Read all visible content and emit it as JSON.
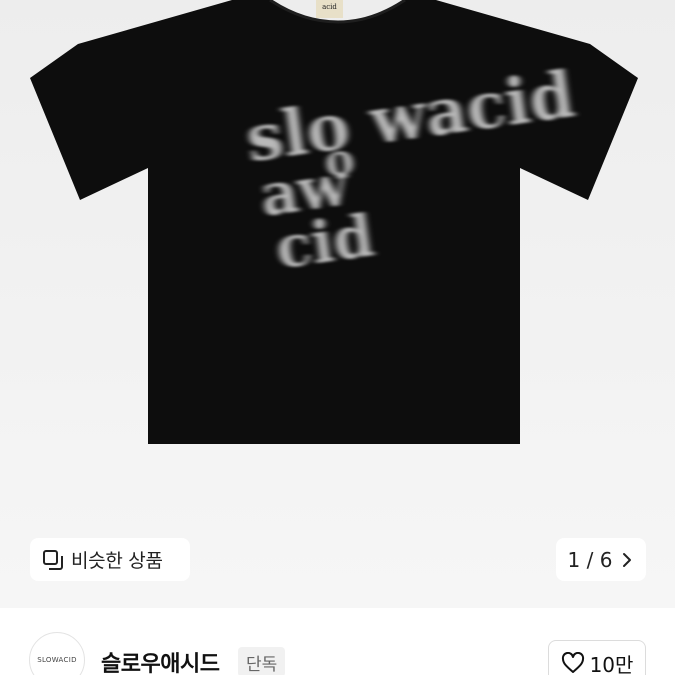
{
  "gallery": {
    "similar_label": "비슷한 상품",
    "pager_text": "1 / 6",
    "icons": {
      "similar": "similar-items-icon",
      "next": "chevron-right-icon"
    }
  },
  "shirt": {
    "neck_label": "acid",
    "graphic_text": "slo wacid"
  },
  "brand": {
    "logo_text": "SLOWACID",
    "name": "슬로우애시드",
    "badge": "단독",
    "likes": "10만",
    "like_icon": "heart-icon"
  },
  "colors": {
    "shirt": "#0d0d0d",
    "graphic": "#c8c8c8",
    "background": "#f0f0f0"
  }
}
